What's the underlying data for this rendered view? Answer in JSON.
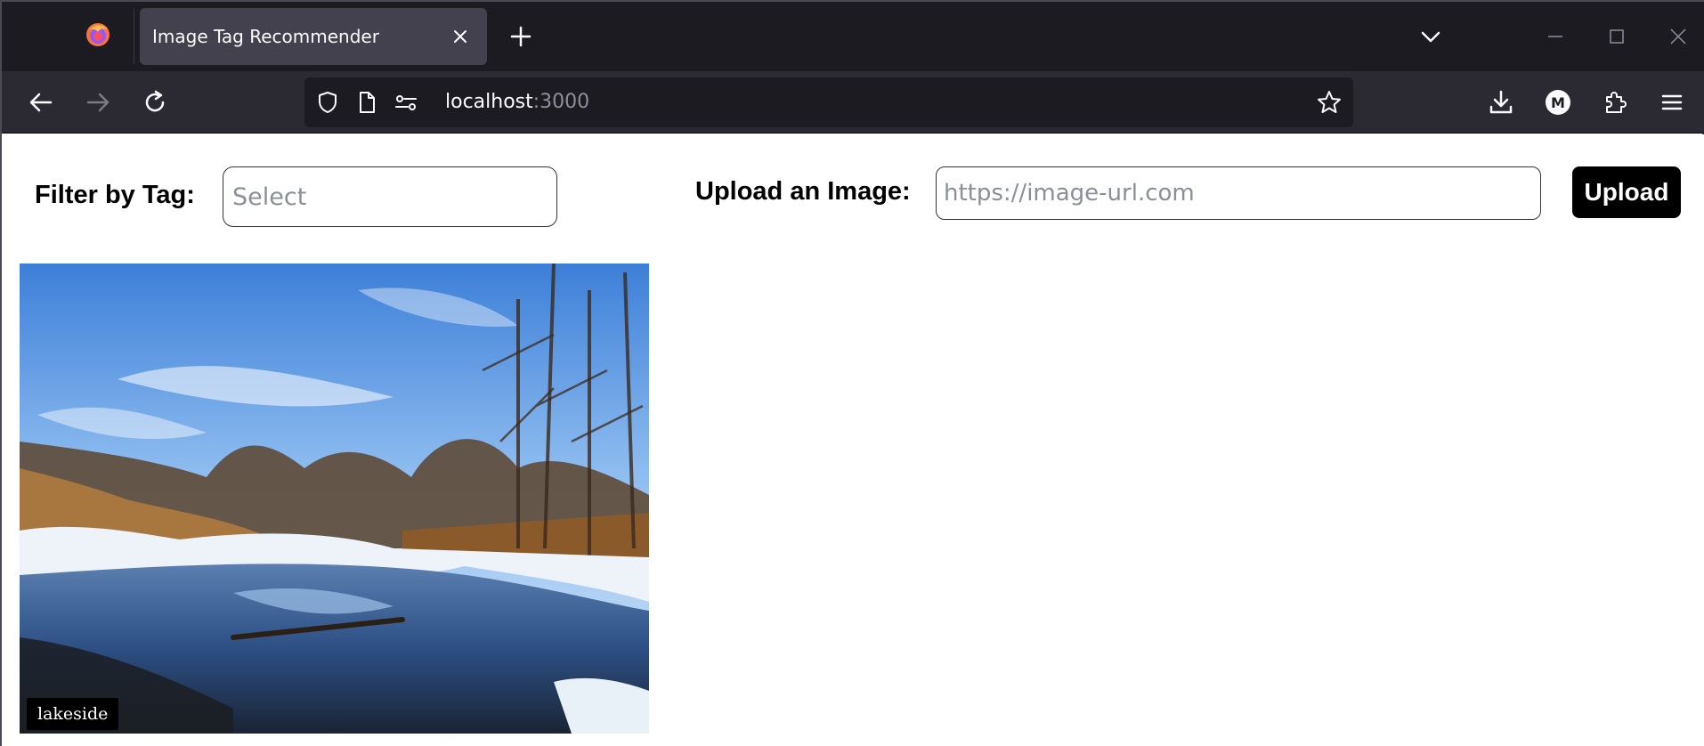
{
  "browser": {
    "tab": {
      "title": "Image Tag Recommender"
    },
    "address": {
      "host": "localhost",
      "port": ":3000"
    }
  },
  "app": {
    "filter": {
      "label": "Filter by Tag:",
      "placeholder": "Select"
    },
    "upload": {
      "label": "Upload an Image:",
      "placeholder": "https://image-url.com",
      "button_label": "Upload"
    },
    "gallery": [
      {
        "tag": "lakeside"
      }
    ]
  },
  "icons": {
    "browser_logo": "firefox-icon",
    "tab_close": "close-icon",
    "new_tab": "plus-icon",
    "tab_list": "chevron-down-icon",
    "back": "arrow-left-icon",
    "forward": "arrow-right-icon",
    "reload": "reload-icon",
    "tracking": "shield-icon",
    "page_info": "page-icon",
    "permissions": "settings-sliders-icon",
    "bookmark": "star-icon",
    "downloads": "download-icon",
    "account": "account-avatar-icon",
    "extensions": "puzzle-icon",
    "menu": "hamburger-menu-icon"
  },
  "colors": {
    "tabbar_bg": "#1c1b22",
    "navbar_bg": "#2b2a33",
    "active_tab_bg": "#42414d",
    "upload_button_bg": "#000000",
    "tag_badge_bg": "#000000"
  },
  "avatar_letter": "M"
}
